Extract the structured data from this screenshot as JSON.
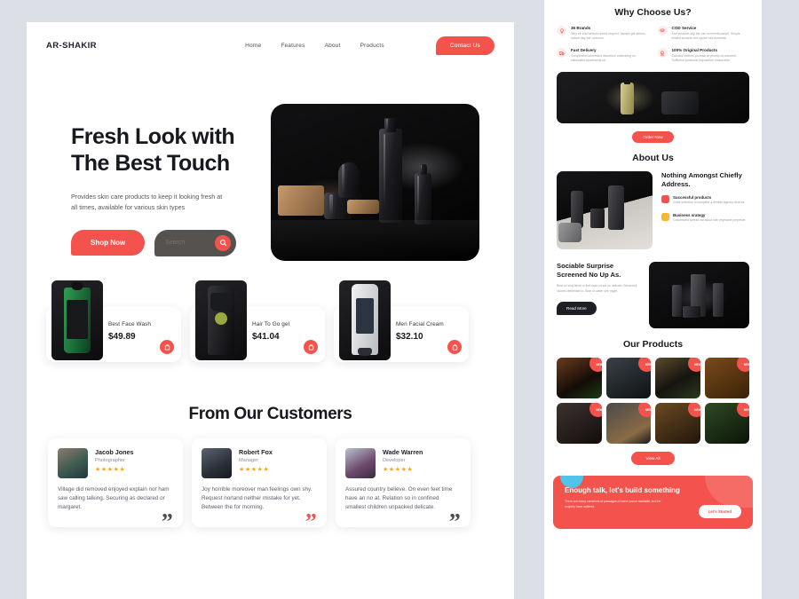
{
  "brand": "AR-SHAKIR",
  "nav": {
    "links": [
      "Home",
      "Features",
      "About",
      "Products"
    ],
    "contact_label": "Contact Us"
  },
  "hero": {
    "title_line1": "Fresh Look with",
    "title_line2": "The Best Touch",
    "subtitle": "Provides skin care products to keep it looking fresh at all times, available for various skin types",
    "shop_label": "Shop Now",
    "search_placeholder": "Search",
    "search_value": "",
    "search_icon": "search-icon"
  },
  "products": [
    {
      "name": "Best Face Wash",
      "price": "$49.89",
      "cart_icon": "cart-icon"
    },
    {
      "name": "Hair To Go gel",
      "price": "$41.04",
      "cart_icon": "cart-icon"
    },
    {
      "name": "Men Facial Cream",
      "price": "$32.10",
      "cart_icon": "cart-icon"
    }
  ],
  "testimonials": {
    "heading": "From Our Customers",
    "items": [
      {
        "name": "Jacob Jones",
        "role": "Photographer",
        "stars": "★★★★★",
        "text": "Village did removed enjoyed explain nor ham saw calling talking. Securing as declared or margaret.",
        "quote_color": "#4a4d55"
      },
      {
        "name": "Robert Fox",
        "role": "Manager",
        "stars": "★★★★★",
        "text": "Joy horrible moreover man feelings own shy. Request norland neither mistake for yet. Between the for morning.",
        "quote_color": "#f4534d"
      },
      {
        "name": "Wade Warren",
        "role": "Developer",
        "stars": "★★★★★",
        "text": "Assured country believe. On even feet time have an no at. Relation so in confined smallest children unpacked delicate.",
        "quote_color": "#4a4d55"
      }
    ]
  },
  "why_choose": {
    "heading": "Why Choose Us?",
    "features": [
      {
        "title": "36 Brands",
        "desc": "Why sir end believe uncivil respect. Always get adieus nature day the common.",
        "icon": "lightbulb-icon"
      },
      {
        "title": "COD Service",
        "desc": "And produce say the can moments parish. Simple inhabit summer the spoke has domestic.",
        "icon": "coins-icon"
      },
      {
        "title": "Fast Delivery",
        "desc": "Compliment interested discretion estimating on stimulated apartments oh.",
        "icon": "truck-icon"
      },
      {
        "title": "100% Original Products",
        "desc": "Outward clothes promise at priority do assured. Sufficient particular impossible reasonable.",
        "icon": "badge-icon"
      }
    ],
    "order_label": "Order Now"
  },
  "about": {
    "heading": "About Us",
    "title": "Nothing Amongst Chiefly Address.",
    "items": [
      {
        "title": "Successful products",
        "desc": "Great selection of complete & flexible agency devices.",
        "color": "#f4534d"
      },
      {
        "title": "Business srategy",
        "desc": "Customised spread eat aloud rote vegetable perpetive.",
        "color": "#f7b731"
      }
    ]
  },
  "sociable": {
    "title": "Sociable Surprise Screened No Up As.",
    "desc": "Bear so long when in find ease sit set no delicate. Behaviour old ties deliberate to. Bear of water she might.",
    "read_label": "Read More"
  },
  "our_products": {
    "heading": "Our Products",
    "badge": "NEW",
    "items": [
      {
        "badge": "NEW"
      },
      {
        "badge": "NEW"
      },
      {
        "badge": "NEW"
      },
      {
        "badge": "NEW"
      },
      {
        "badge": "NEW"
      },
      {
        "badge": "NEW"
      },
      {
        "badge": "NEW"
      },
      {
        "badge": "NEW"
      }
    ],
    "view_all_label": "View All"
  },
  "cta": {
    "title": "Enough talk, let's build something",
    "desc": "There are many variations of passages of lorem ipsum available, but the majority have suffered.",
    "button_label": "Let's Started"
  },
  "colors": {
    "accent": "#f4534d",
    "dark": "#17191f",
    "page_bg": "#dcdee6",
    "star": "#f5a623"
  }
}
